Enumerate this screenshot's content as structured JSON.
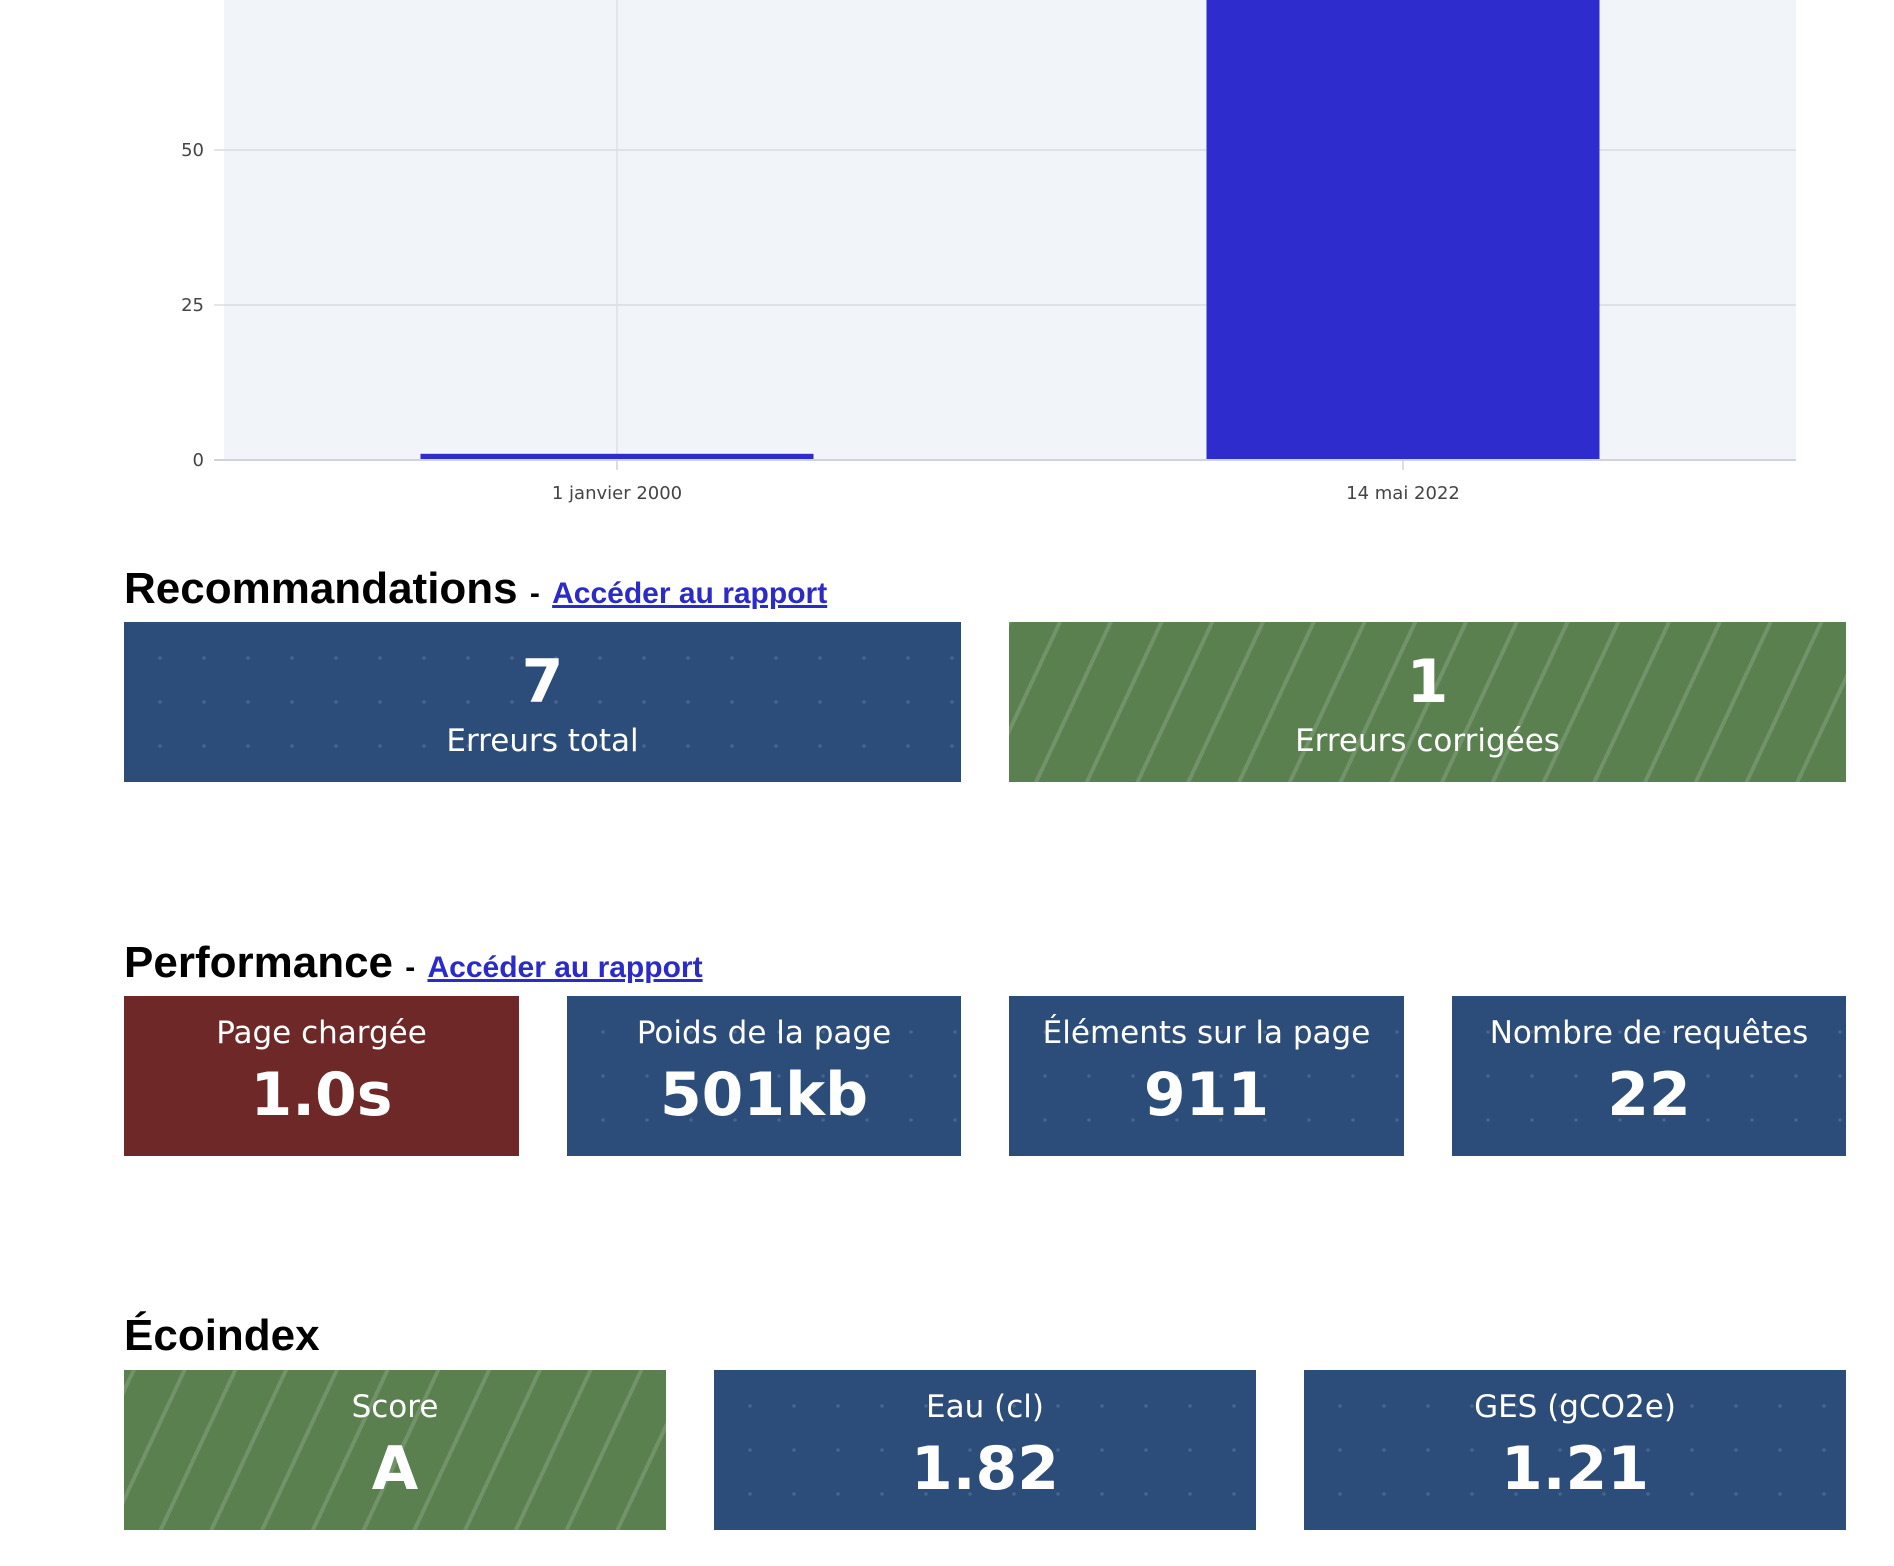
{
  "chart_data": {
    "type": "bar",
    "categories": [
      "1 janvier 2000",
      "14 mai 2022"
    ],
    "values": [
      1,
      78
    ],
    "yticks": [
      0,
      25,
      50
    ],
    "ylim": [
      0,
      78
    ],
    "grid": true,
    "bar_color": "#2e2ccc",
    "plot_background": "#f1f4f8"
  },
  "recommandations": {
    "title": "Recommandations",
    "separator": "-",
    "link": "Accéder au rapport",
    "cards": [
      {
        "value": "7",
        "label": "Erreurs total",
        "color": "#2c4d7a"
      },
      {
        "value": "1",
        "label": "Erreurs corrigées",
        "color": "#5b8050"
      }
    ]
  },
  "performance": {
    "title": "Performance",
    "separator": "-",
    "link": "Accéder au rapport",
    "cards": [
      {
        "label": "Page chargée",
        "value": "1.0s",
        "color": "#6e2828"
      },
      {
        "label": "Poids de la page",
        "value": "501kb",
        "color": "#2c4d7a"
      },
      {
        "label": "Éléments sur la page",
        "value": "911",
        "color": "#2c4d7a"
      },
      {
        "label": "Nombre de requêtes",
        "value": "22",
        "color": "#2c4d7a"
      }
    ]
  },
  "ecoindex": {
    "title": "Écoindex",
    "cards": [
      {
        "label": "Score",
        "value": "A",
        "color": "#5b8050"
      },
      {
        "label": "Eau (cl)",
        "value": "1.82",
        "color": "#2c4d7a"
      },
      {
        "label": "GES (gCO2e)",
        "value": "1.21",
        "color": "#2c4d7a"
      }
    ]
  }
}
